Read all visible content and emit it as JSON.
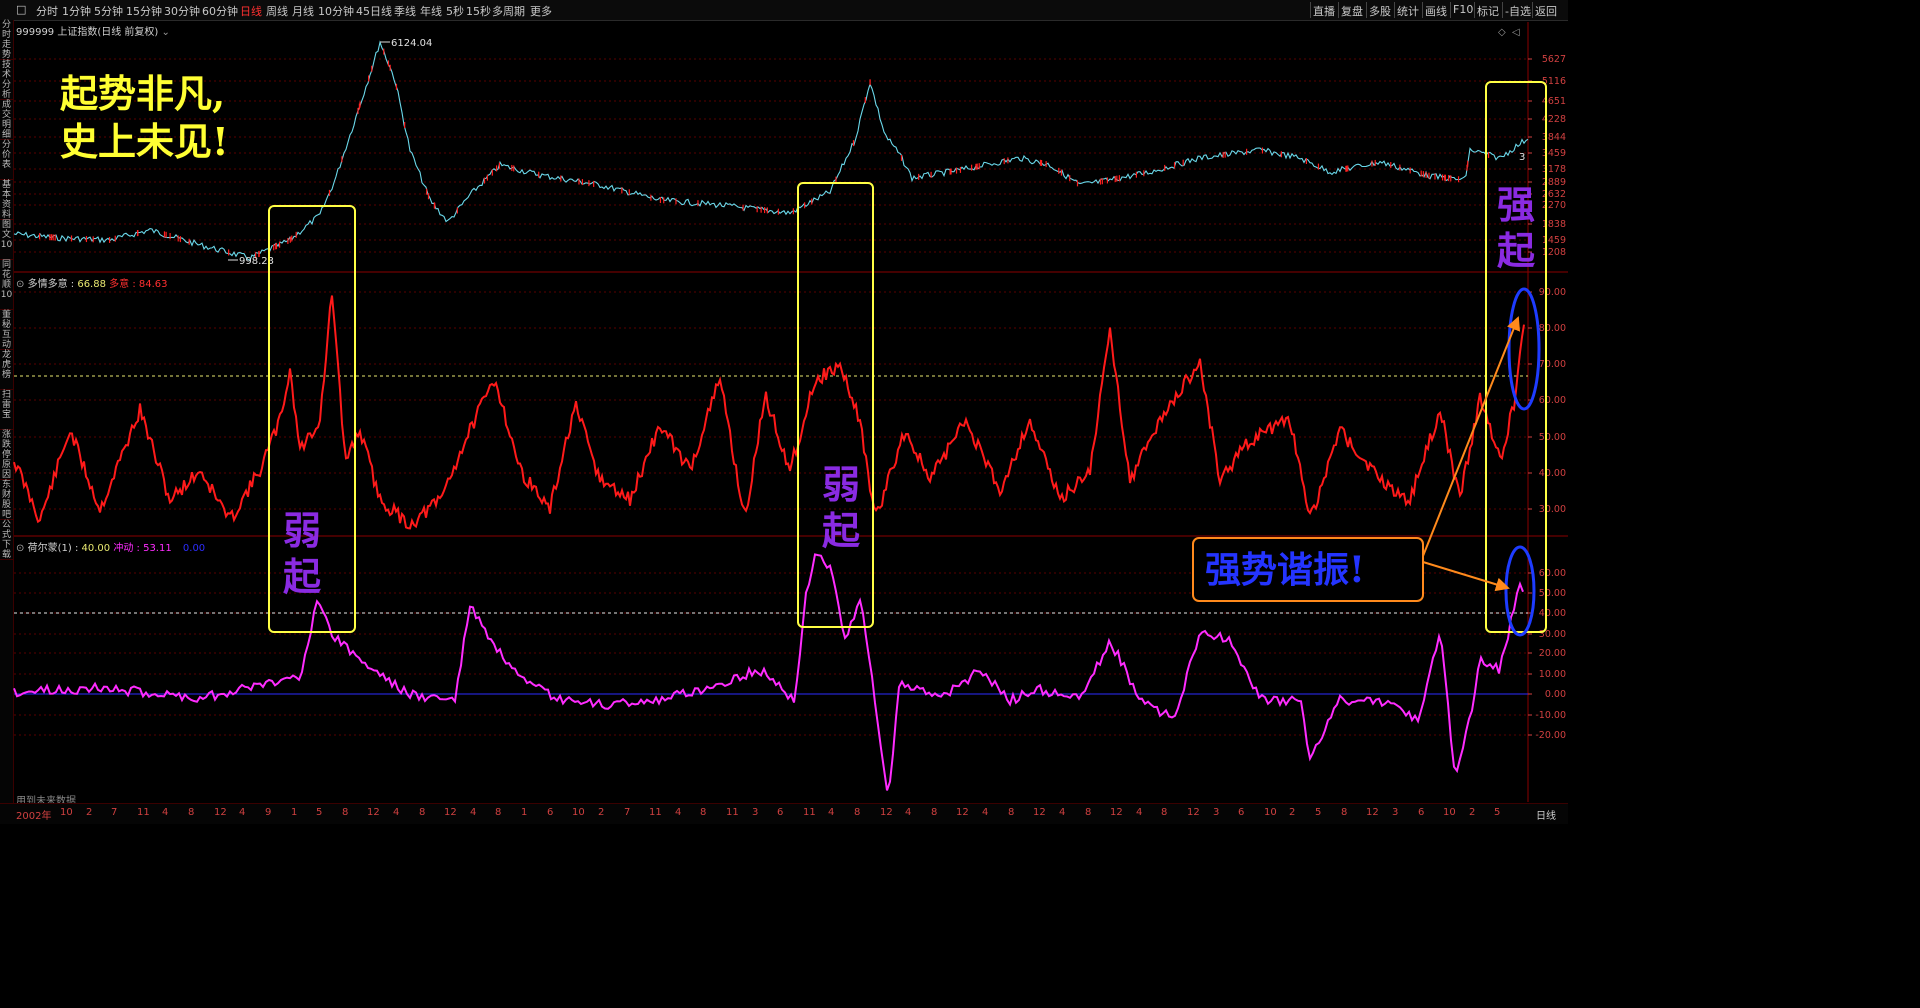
{
  "toolbar": {
    "periods": [
      "分时",
      "1分钟",
      "5分钟",
      "15分钟",
      "30分钟",
      "60分钟",
      "日线",
      "周线",
      "月线",
      "10分钟",
      "45日线",
      "季线",
      "年线",
      "5秒",
      "15秒",
      "多周期",
      "更多"
    ],
    "active_period": "日线",
    "right_buttons": [
      "直播",
      "复盘",
      "多股",
      "统计",
      "画线",
      "F10",
      "标记",
      "自选",
      "返回"
    ]
  },
  "sidebar": {
    "tabs": [
      "分时走势",
      "技术分析",
      "成交明细",
      "分价表",
      "基本资料",
      "图文10",
      "同花顺10",
      "董秘互动",
      "龙虎榜",
      "扫雷宝",
      "涨跌停原因",
      "东财股吧",
      "公式下载"
    ]
  },
  "main_chart": {
    "title": "999999 上证指数(日线 前复权)",
    "high_label": "6124.04",
    "low_label": "998.23",
    "y_ticks": [
      "5627",
      "5116",
      "4651",
      "4228",
      "3844",
      "3459",
      "3178",
      "2889",
      "2632",
      "2270",
      "1838",
      "1459",
      "1208"
    ],
    "partial_tick": "3"
  },
  "indicator1": {
    "name": "多情多意",
    "value1": "66.88",
    "label2": "多意",
    "value2": "84.63",
    "y_ticks": [
      "90.00",
      "80.00",
      "70.00",
      "60.00",
      "50.00",
      "40.00",
      "30.00"
    ]
  },
  "indicator2": {
    "name": "荷尔蒙(1)",
    "value1": "40.00",
    "label2": "冲动",
    "value2": "53.11",
    "value3": "0.00",
    "y_ticks": [
      "60.00",
      "50.00",
      "40.00",
      "30.00",
      "20.00",
      "10.00",
      "0.00",
      "-10.00",
      "-20.00"
    ]
  },
  "annotations": {
    "headline_line1": "起势非凡,",
    "headline_line2": "史上未见!",
    "weak_rise": "弱起",
    "strong_rise": "强起",
    "resonance": "强势谐振!"
  },
  "bottom": {
    "future_data_note": "用到未来数据",
    "start_year": "2002年",
    "months": [
      "10",
      "2",
      "7",
      "11",
      "4",
      "8",
      "12",
      "4",
      "9",
      "1",
      "5",
      "8",
      "12",
      "4",
      "8",
      "12",
      "4",
      "8",
      "1",
      "6",
      "10",
      "2",
      "7",
      "11",
      "4",
      "8",
      "11",
      "3",
      "6",
      "11",
      "4",
      "8",
      "12",
      "4",
      "8",
      "12",
      "4",
      "8",
      "12",
      "4",
      "8",
      "12",
      "4",
      "8",
      "12",
      "3",
      "6",
      "10",
      "2",
      "5",
      "8",
      "12",
      "3",
      "6",
      "10",
      "2",
      "5"
    ],
    "period_label": "日线"
  },
  "colors": {
    "price_line": "#6ad8ea",
    "candle_up": "#ff2020",
    "indicator1_line": "#ff1a1a",
    "indicator2_line": "#ff2cff",
    "annotation_box": "#ffff44",
    "annotation_text_purple": "#8a2be2",
    "headline_text": "#ffff33",
    "blue_ellipse": "#1e3cff",
    "orange_arrow": "#ff8a1c"
  }
}
